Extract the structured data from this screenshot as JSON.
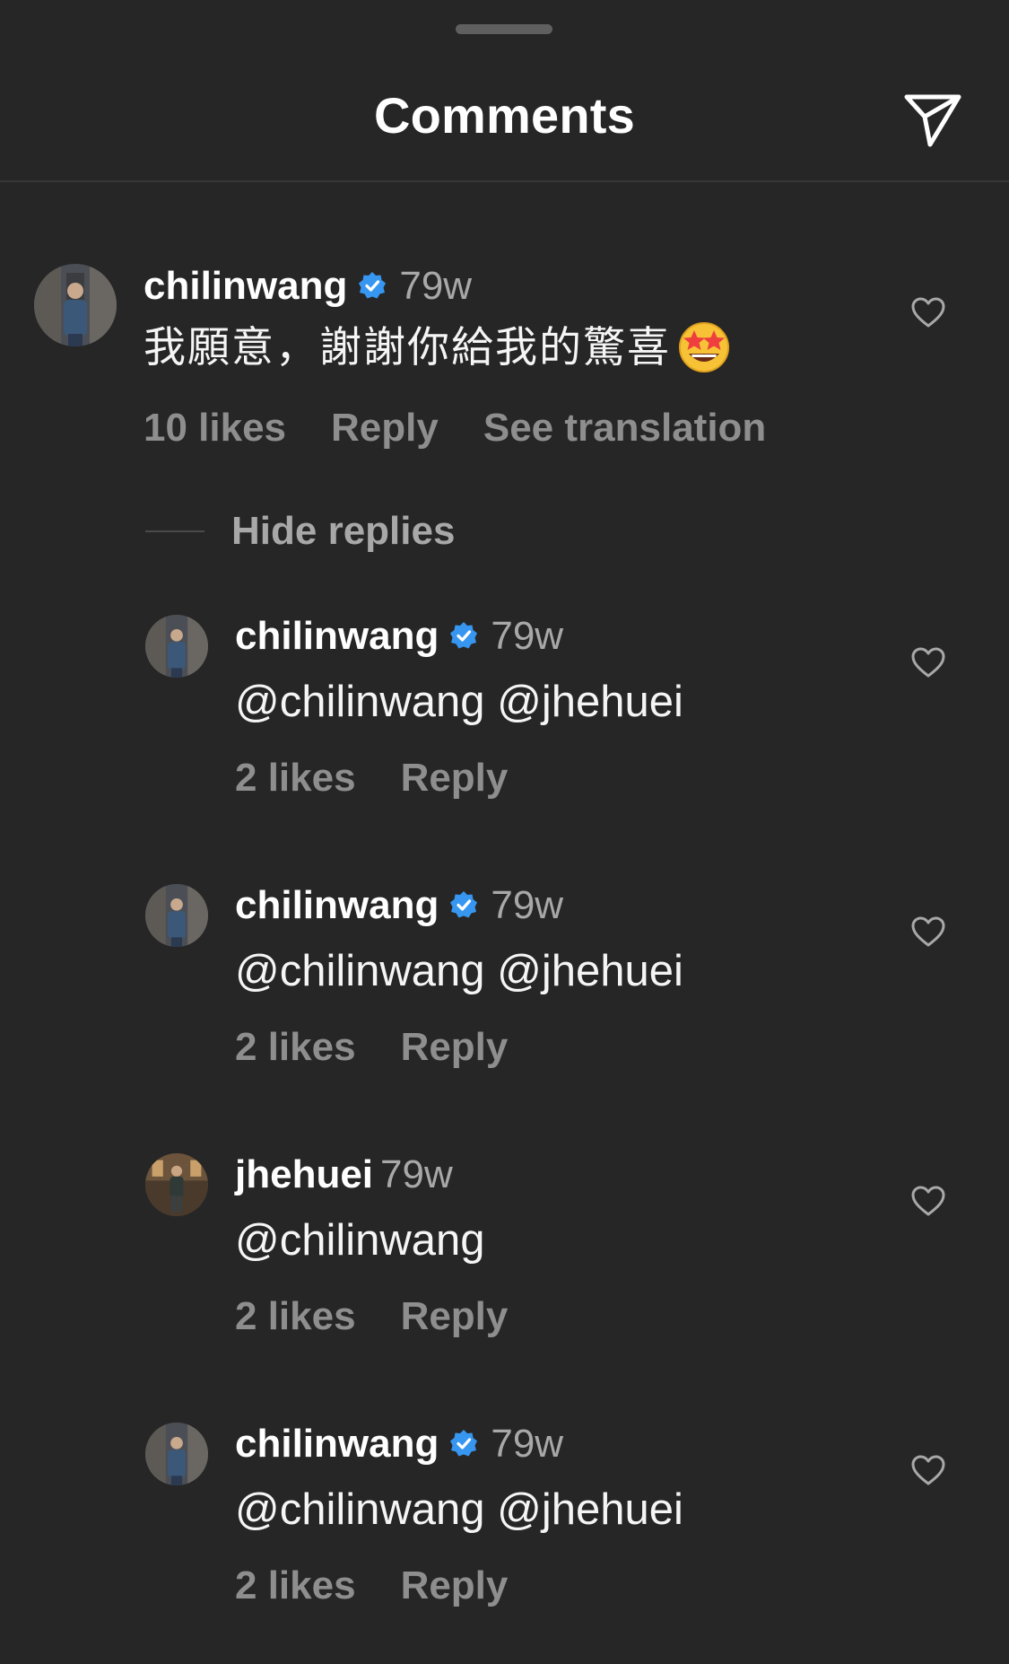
{
  "header": {
    "title": "Comments",
    "share_icon": "paper-plane-icon"
  },
  "colors": {
    "background": "#262626",
    "verified_badge": "#3797f0",
    "secondary_text": "#8e8e8e"
  },
  "main_comment": {
    "username": "chilinwang",
    "verified": true,
    "time": "79w",
    "text": "我願意，謝謝你給我的驚喜",
    "emoji": "star-struck-emoji",
    "likes": "10 likes",
    "reply_label": "Reply",
    "translate_label": "See translation"
  },
  "hide_replies_label": "Hide replies",
  "replies": [
    {
      "username": "chilinwang",
      "verified": true,
      "time": "79w",
      "text": "@chilinwang @jhehuei",
      "likes": "2 likes",
      "reply_label": "Reply"
    },
    {
      "username": "chilinwang",
      "verified": true,
      "time": "79w",
      "text": "@chilinwang @jhehuei",
      "likes": "2 likes",
      "reply_label": "Reply"
    },
    {
      "username": "jhehuei",
      "verified": false,
      "time": "79w",
      "text": "@chilinwang",
      "likes": "2 likes",
      "reply_label": "Reply"
    },
    {
      "username": "chilinwang",
      "verified": true,
      "time": "79w",
      "text": "@chilinwang @jhehuei",
      "likes": "2 likes",
      "reply_label": "Reply"
    }
  ]
}
